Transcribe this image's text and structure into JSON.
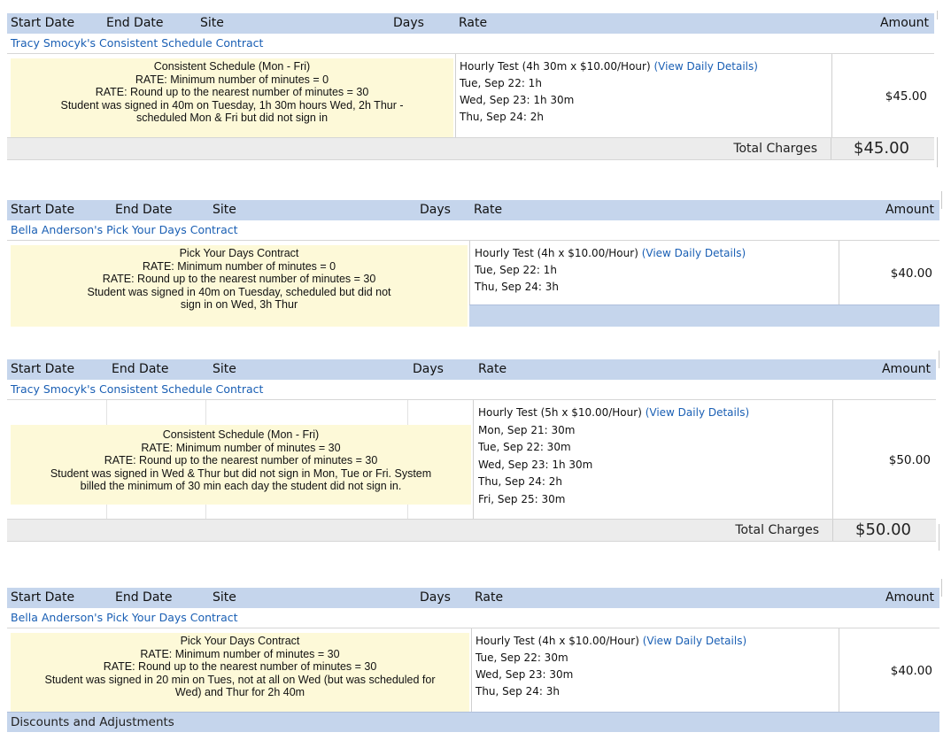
{
  "columns": {
    "start_date": "Start Date",
    "end_date": "End Date",
    "site": "Site",
    "days": "Days",
    "rate": "Rate",
    "amount": "Amount"
  },
  "blocks": [
    {
      "contract_title": "Tracy Smocyk's Consistent Schedule Contract",
      "note_lines": [
        "Consistent Schedule (Mon - Fri)",
        "RATE: Minimum number of minutes = 0",
        "RATE:  Round up to the nearest number of minutes = 30",
        "Student was signed in 40m on Tuesday, 1h 30m hours Wed, 2h Thur -",
        "scheduled Mon & Fri but did not sign in"
      ],
      "rate_summary": "Hourly Test (4h 30m x $10.00/Hour)",
      "view_details": "(View Daily Details)",
      "rate_lines": [
        "Tue, Sep 22: 1h",
        "Wed, Sep 23: 1h 30m",
        "Thu, Sep 24: 2h"
      ],
      "amount": "$45.00",
      "total_label": "Total Charges",
      "total_value": "$45.00"
    },
    {
      "contract_title": "Bella Anderson's Pick Your Days Contract",
      "note_lines": [
        "Pick Your Days Contract",
        "RATE: Minimum number of minutes = 0",
        "RATE:  Round up to the nearest number of minutes = 30",
        "Student was signed in 40m on Tuesday, scheduled but did not",
        "sign in on Wed, 3h Thur"
      ],
      "rate_summary": "Hourly Test (4h x $10.00/Hour)",
      "view_details": "(View Daily Details)",
      "rate_lines": [
        "Tue, Sep 22: 1h",
        "Thu, Sep 24: 3h"
      ],
      "amount": "$40.00"
    },
    {
      "contract_title": "Tracy Smocyk's Consistent Schedule Contract",
      "note_lines": [
        "Consistent Schedule (Mon - Fri)",
        "RATE: Minimum number of minutes = 30",
        "RATE:  Round up to the nearest number of minutes = 30",
        "Student was signed in Wed & Thur but did not sign in Mon, Tue or Fri.  System",
        "billed the minimum of 30 min each day the student did not sign in."
      ],
      "rate_summary": "Hourly Test (5h x $10.00/Hour)",
      "view_details": "(View Daily Details)",
      "rate_lines": [
        "Mon, Sep 21: 30m",
        "Tue, Sep 22: 30m",
        "Wed, Sep 23: 1h 30m",
        "Thu, Sep 24: 2h",
        "Fri, Sep 25: 30m"
      ],
      "amount": "$50.00",
      "total_label": "Total Charges",
      "total_value": "$50.00"
    },
    {
      "contract_title": "Bella Anderson's Pick Your Days Contract",
      "note_lines": [
        "Pick Your Days Contract",
        "RATE: Minimum number of minutes = 30",
        "RATE:  Round up to the nearest number of minutes = 30",
        "Student was signed in 20 min on Tues, not at all on Wed (but was scheduled for",
        "Wed) and Thur for 2h 40m"
      ],
      "rate_summary": "Hourly Test (4h x $10.00/Hour)",
      "view_details": "(View Daily Details)",
      "rate_lines": [
        "Tue, Sep 22: 30m",
        "Wed, Sep 23: 30m",
        "Thu, Sep 24: 3h"
      ],
      "amount": "$40.00",
      "discounts_label": "Discounts and Adjustments"
    }
  ]
}
